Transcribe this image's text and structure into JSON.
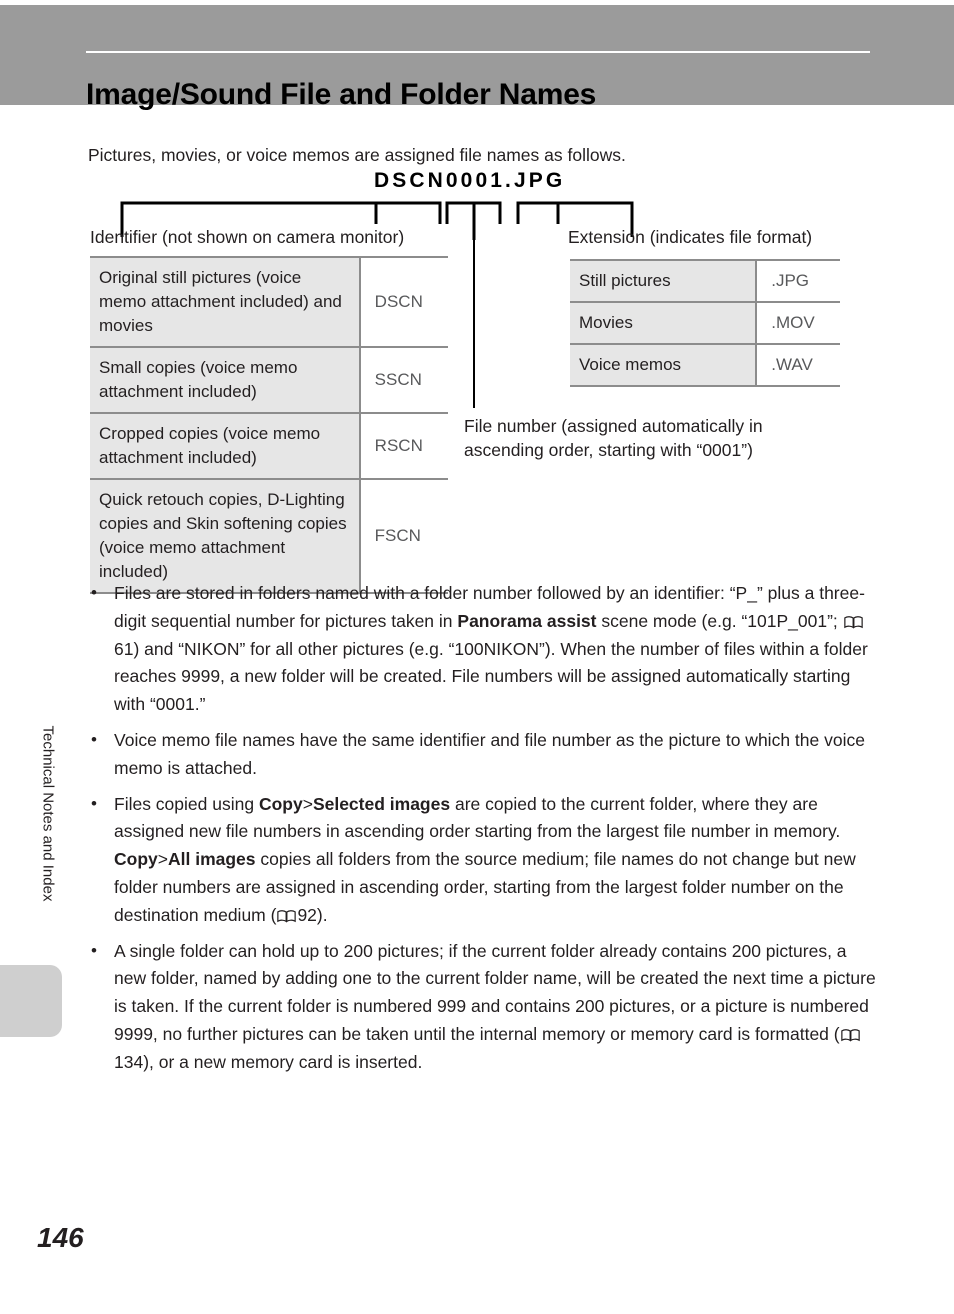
{
  "header": {
    "title": "Image/Sound File and Folder Names",
    "bar_color": "#9b9b9b"
  },
  "side_tab": {
    "label": "Technical Notes and Index"
  },
  "intro": "Pictures, movies, or voice memos are assigned file names as follows.",
  "diagram": {
    "filename": "DSCN0001.JPG",
    "identifier_label": "Identifier (not shown on camera monitor)",
    "extension_label": "Extension (indicates file format)",
    "file_number_label": "File number (assigned automatically in ascending order, starting with “0001”)",
    "identifier_table": [
      {
        "desc": "Original still pictures (voice memo attachment included) and movies",
        "code": "DSCN"
      },
      {
        "desc": "Small copies (voice memo attachment included)",
        "code": "SSCN"
      },
      {
        "desc": "Cropped copies (voice memo attachment included)",
        "code": "RSCN"
      },
      {
        "desc": "Quick retouch copies, D-Lighting copies and Skin softening copies (voice memo attachment included)",
        "code": "FSCN"
      }
    ],
    "extension_table": [
      {
        "desc": "Still pictures",
        "code": ".JPG"
      },
      {
        "desc": "Movies",
        "code": ".MOV"
      },
      {
        "desc": "Voice memos",
        "code": ".WAV"
      }
    ]
  },
  "bullets": {
    "b1_p1": "Files are stored in folders named with a folder number followed by an identifier: “P_” plus a three-digit sequential number for pictures taken in ",
    "b1_bold1": "Panorama assist",
    "b1_p2": " scene mode (e.g. “101P_001”; ",
    "b1_ref1": "61",
    "b1_p3": ") and “NIKON” for all other pictures (e.g. “100NIKON”). When the number of files within a folder reaches 9999, a new folder will be created. File numbers will be assigned automatically starting with “0001.”",
    "b2": "Voice memo file names have the same identifier and file number as the picture to which the voice memo is attached.",
    "b3_p1": "Files copied using ",
    "b3_bold1": "Copy",
    "b3_gt1": ">",
    "b3_bold2": "Selected images",
    "b3_p2": " are copied to the current folder, where they are assigned new file numbers in ascending order starting from the largest file number in memory. ",
    "b3_bold3": "Copy",
    "b3_gt2": ">",
    "b3_bold4": "All images",
    "b3_p3": " copies all folders from the source medium; file names do not change but new folder numbers are assigned in ascending order, starting from the largest folder number on the destination medium (",
    "b3_ref1": "92",
    "b3_p4": ").",
    "b4_p1": "A single folder can hold up to 200 pictures; if the current folder already contains 200 pictures, a new folder, named by adding one to the current folder name, will be created the next time a picture is taken. If the current folder is numbered 999 and contains 200 pictures, or a picture is numbered 9999, no further pictures can be taken until the internal memory or memory card is formatted (",
    "b4_ref1": "134",
    "b4_p2": "), or a new memory card is inserted."
  },
  "footer": {
    "page_number": "146"
  },
  "icons": {
    "bullet": "bullet-dot-icon",
    "book": "book-page-reference-icon"
  }
}
